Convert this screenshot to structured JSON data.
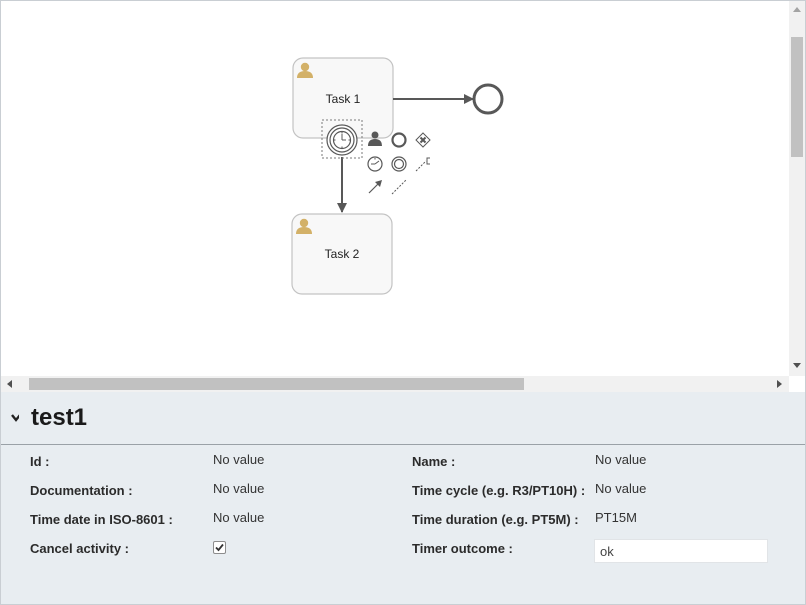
{
  "diagram": {
    "tasks": [
      {
        "label": "Task 1"
      },
      {
        "label": "Task 2"
      }
    ],
    "colors": {
      "task_border": "#c3c3c3",
      "task_fill": "#f8f8f8",
      "user_icon": "#d3b168",
      "flow": "#585858"
    },
    "icons": [
      "user-task-icon",
      "timer-event-icon",
      "end-event-icon"
    ],
    "context_pad": [
      "append-user-task-icon",
      "append-end-event-icon",
      "append-gateway-icon",
      "append-timer-event-icon",
      "append-intermediate-event-icon",
      "append-text-annotation-icon",
      "connect-arrow-icon",
      "association-icon"
    ]
  },
  "properties": {
    "title": "test1",
    "fields": {
      "id": {
        "label": "Id :",
        "value": "No value"
      },
      "documentation": {
        "label": "Documentation :",
        "value": "No value"
      },
      "time_date": {
        "label": "Time date in ISO-8601 :",
        "value": "No value"
      },
      "cancel_activity": {
        "label": "Cancel activity :",
        "checked": true
      },
      "name": {
        "label": "Name :",
        "value": "No value"
      },
      "time_cycle": {
        "label": "Time cycle (e.g. R3/PT10H) :",
        "value": "No value"
      },
      "time_duration": {
        "label": "Time duration (e.g. PT5M) :",
        "value": "PT15M"
      },
      "timer_outcome": {
        "label": "Timer outcome :",
        "value": "ok"
      }
    }
  }
}
